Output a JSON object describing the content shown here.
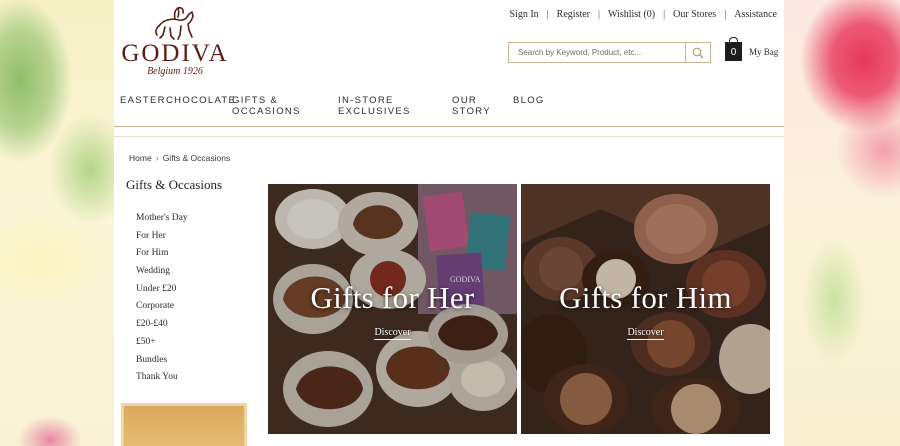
{
  "brand": {
    "name": "GODIVA",
    "tagline": "Belgium 1926"
  },
  "utility_nav": {
    "sign_in": "Sign In",
    "register": "Register",
    "wishlist": "Wishlist (0)",
    "our_stores": "Our Stores",
    "assistance": "Assistance"
  },
  "search": {
    "placeholder": "Search by Keyword, Product, etc..."
  },
  "bag": {
    "count": "0",
    "label": "My Bag"
  },
  "main_nav": [
    {
      "label": "EASTER"
    },
    {
      "label": "CHOCOLATE"
    },
    {
      "label": "GIFTS & OCCASIONS"
    },
    {
      "label": "IN-STORE EXCLUSIVES"
    },
    {
      "label": "OUR STORY"
    },
    {
      "label": "BLOG"
    }
  ],
  "breadcrumb": [
    "Home",
    "Gifts & Occasions"
  ],
  "sidebar": {
    "title": "Gifts & Occasions",
    "items": [
      "Mother's Day",
      "For Her",
      "For Him",
      "Wedding",
      "Under £20",
      "Corporate",
      "£20-£40",
      "£50+",
      "Bundles",
      "Thank You"
    ]
  },
  "tiles": [
    {
      "title": "Gifts for Her",
      "cta": "Discover",
      "packaging_text": "GODIVA"
    },
    {
      "title": "Gifts for Him",
      "cta": "Discover"
    }
  ],
  "colors": {
    "brand_brown": "#5a1e14",
    "accent_gold": "#c9b48f"
  }
}
